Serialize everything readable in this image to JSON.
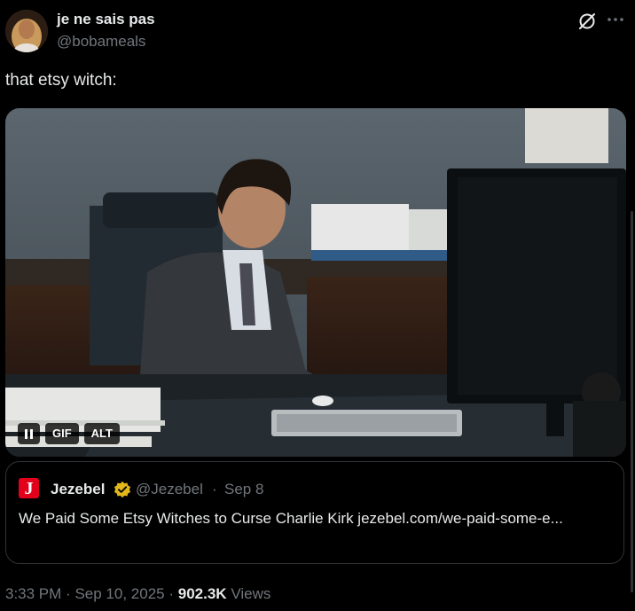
{
  "author": {
    "display_name": "je ne sais pas",
    "handle": "@bobameals",
    "avatar_icon": "avatar"
  },
  "header_icons": [
    "grok-icon",
    "more-icon"
  ],
  "tweet": {
    "text": "that etsy witch:"
  },
  "media": {
    "type": "GIF",
    "controls": {
      "pause_icon": "pause-icon",
      "gif_label": "GIF",
      "alt_label": "ALT"
    }
  },
  "quote": {
    "logo_letter": "J",
    "name": "Jezebel",
    "verified_badge_color": "#e2b719",
    "handle": "@Jezebel",
    "separator": "·",
    "date": "Sep 8",
    "text": "We Paid Some Etsy Witches to Curse Charlie Kirk jezebel.com/we-paid-some-e..."
  },
  "meta": {
    "time": "3:33 PM",
    "sep1": "·",
    "date": "Sep 10, 2025",
    "sep2": "·",
    "views_count": "902.3K",
    "views_label": "Views"
  },
  "colors": {
    "background": "#000000",
    "text_primary": "#e7e9ea",
    "text_secondary": "#71767b",
    "border": "#2f3336",
    "jezebel_red": "#e2001a"
  }
}
